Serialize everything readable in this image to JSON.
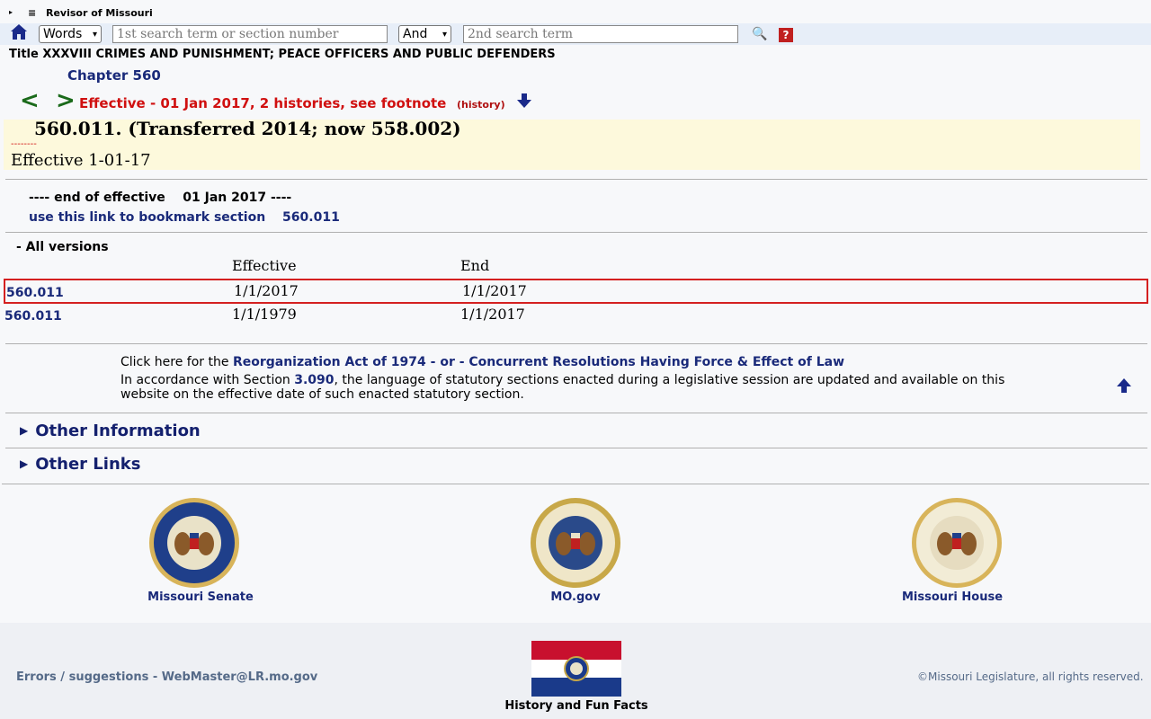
{
  "topbar": {
    "title": "Revisor of Missouri",
    "expand_glyph": "▸",
    "menu_glyph": "≡"
  },
  "search": {
    "mode_selected": "Words",
    "term1_placeholder": "1st search term or section number",
    "operator_selected": "And",
    "term2_placeholder": "2nd search term",
    "search_glyph": "🔍",
    "help_glyph": "?"
  },
  "heading": {
    "title_line": "Title XXXVIII CRIMES AND PUNISHMENT; PEACE OFFICERS AND PUBLIC DEFENDERS",
    "chapter": "Chapter 560",
    "prev_glyph": "<",
    "next_glyph": ">",
    "effective_notice": "Effective - 01 Jan 2017, 2 histories, see footnote",
    "history_link": "(history)"
  },
  "section": {
    "title": "560.011.  (Transferred 2014; now 558.002)",
    "dashes": "--------",
    "effective": "Effective 1-01-17"
  },
  "end_of_effective": "---- end of effective    01 Jan 2017 ----",
  "bookmark": {
    "label": "use this link to bookmark section",
    "section": "560.011"
  },
  "versions": {
    "heading": "- All versions",
    "col_effective": "Effective",
    "col_end": "End",
    "rows": [
      {
        "section": "560.011",
        "effective": "1/1/2017",
        "end": "1/1/2017",
        "highlight": true
      },
      {
        "section": "560.011",
        "effective": "1/1/1979",
        "end": "1/1/2017",
        "highlight": false
      }
    ]
  },
  "notice": {
    "click_prefix": "Click here for the ",
    "click_link": "Reorganization Act of 1974 - or - Concurrent Resolutions Having Force & Effect of Law",
    "accord_prefix": "In accordance with Section ",
    "accord_link": "3.090",
    "accord_suffix": ", the language of statutory sections enacted during a legislative session are updated and available on this website on the effective date of such enacted statutory section."
  },
  "expanders": {
    "other_info": "Other Information",
    "other_links": "Other Links",
    "glyph": "▶"
  },
  "seals": [
    {
      "label": "Missouri Senate"
    },
    {
      "label": "MO.gov"
    },
    {
      "label": "Missouri House"
    }
  ],
  "footer": {
    "errors": "Errors / suggestions - WebMaster@LR.mo.gov",
    "flag_label": "History and Fun Facts",
    "rights": "©Missouri Legislature, all rights reserved."
  },
  "colors": {
    "link": "#1a2a7a",
    "alert": "#d01010",
    "highlight_box": "#d42020",
    "section_bg": "#fdf9dc"
  }
}
